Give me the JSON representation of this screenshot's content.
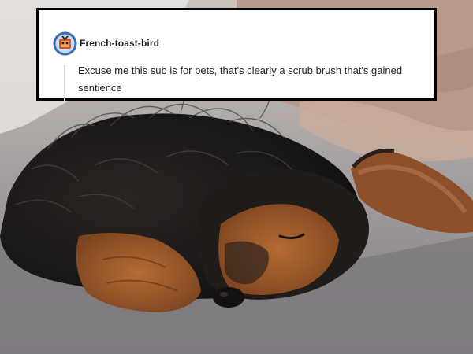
{
  "photo": {
    "subject": "sleeping-dog",
    "colors": {
      "blanket": "#8d8a8c",
      "fur_dark": "#1c1b1b",
      "fur_tan": "#9b592b"
    }
  },
  "comment": {
    "username": "French-toast-bird",
    "text": "Excuse me this sub is for pets, that's clearly a scrub brush that's gained sentience",
    "avatar_icon": "bird-avatar-icon",
    "avatar_color": "#3a6bb0"
  }
}
